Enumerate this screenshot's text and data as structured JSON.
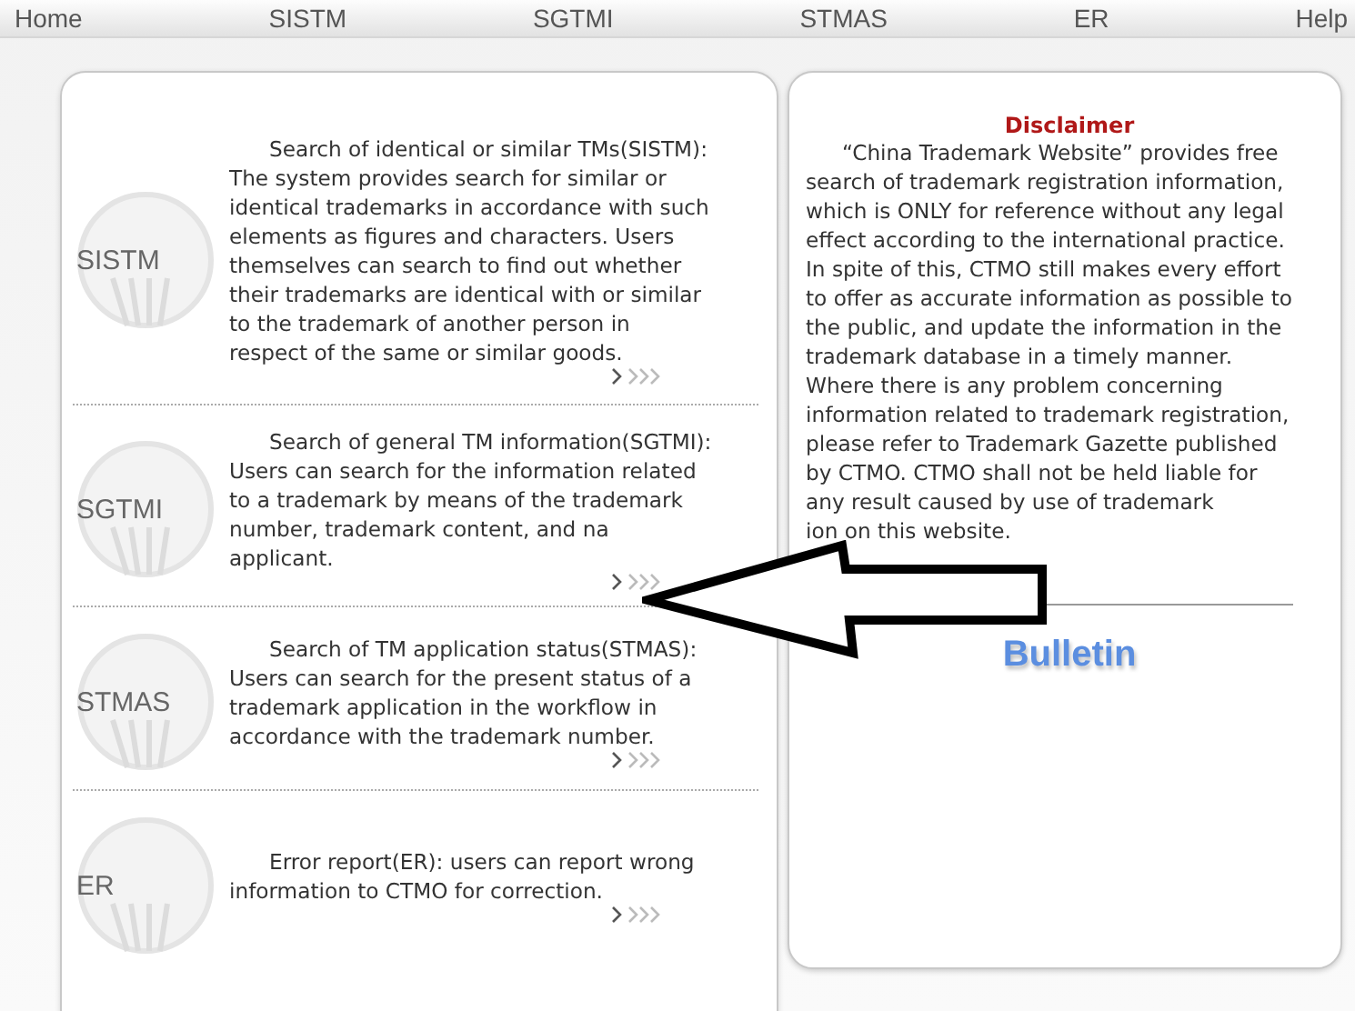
{
  "nav": {
    "items": [
      "Home",
      "SISTM",
      "SGTMI",
      "STMAS",
      "ER",
      "Help"
    ]
  },
  "services": [
    {
      "badge": "SISTM",
      "description": "Search of identical or similar TMs(SISTM):\nThe system provides search for similar or\nidentical trademarks in accordance with such\nelements as figures and characters. Users\nthemselves can search to find out whether\ntheir trademarks are identical with or similar\nto the trademark of another person in\nrespect of the same or similar goods."
    },
    {
      "badge": "SGTMI",
      "description": "Search of general TM information(SGTMI):\nUsers can search for the information related\nto a trademark by means of the trademark\nnumber, trademark content, and na\napplicant."
    },
    {
      "badge": "STMAS",
      "description": "Search of TM application status(STMAS):\nUsers can search for the present status of a\ntrademark application in the workflow in\naccordance with the trademark number."
    },
    {
      "badge": "ER",
      "description": "Error report(ER): users can report wrong\ninformation to CTMO for correction."
    }
  ],
  "disclaimer": {
    "title": "Disclaimer",
    "body": "“China Trademark Website” provides free\nsearch of trademark registration information,\nwhich is ONLY for reference without any legal\neffect according to the international practice.\nIn spite of this, CTMO still makes every effort\nto offer as accurate information as possible to\nthe public, and update the information in the\ntrademark database in a timely manner.\nWhere there is any problem concerning\ninformation related to trademark registration,\nplease refer to Trademark Gazette published\nby CTMO. CTMO shall not be held liable for\nany result caused by use of trademark\nion on this website."
  },
  "bulletin": "Bulletin"
}
